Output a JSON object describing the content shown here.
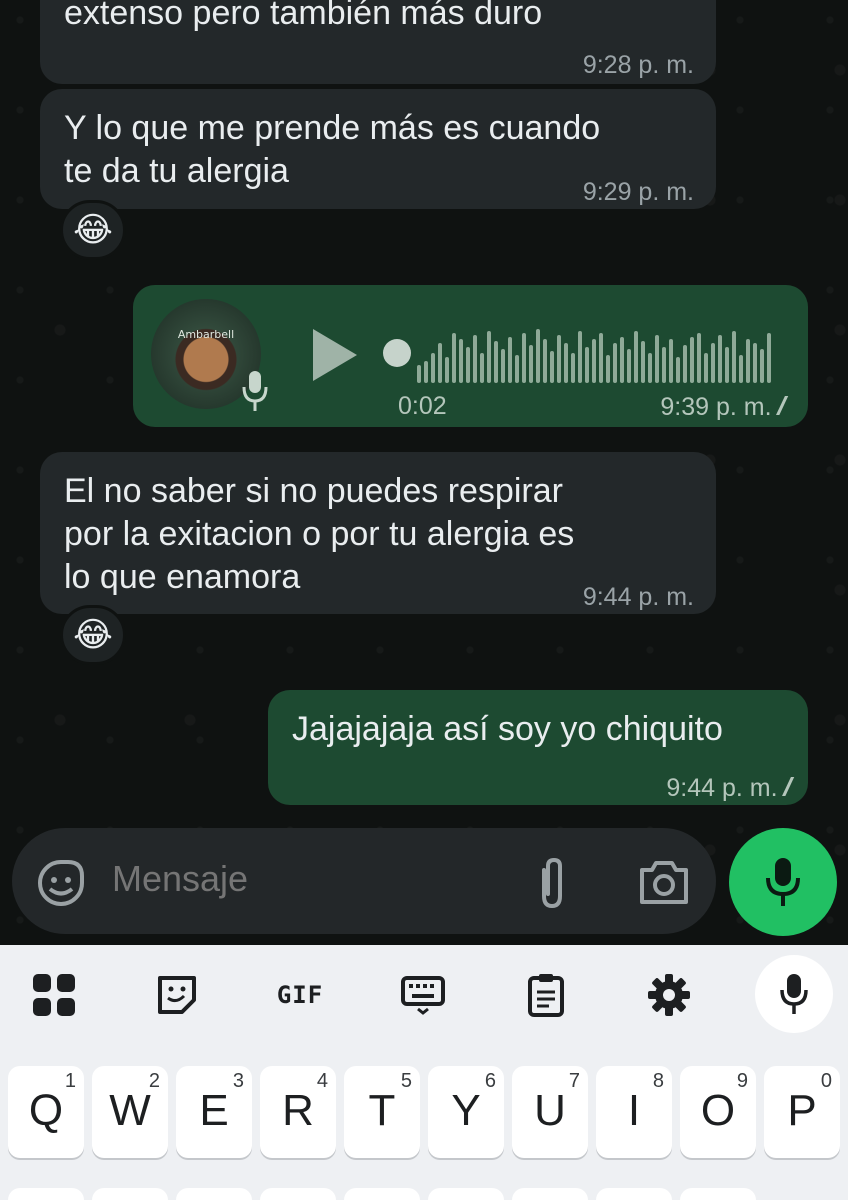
{
  "chat": {
    "messages": [
      {
        "text": "extenso pero también más duro",
        "time": "9:28 p. m."
      },
      {
        "text": "Y lo que me prende más es cuando\nte da tu alergia",
        "time": "9:29 p. m.",
        "reaction": "😂"
      },
      {
        "voice_duration": "0:02",
        "time": "9:39 p. m.",
        "ticks": "//",
        "avatar_label": "Ambarbell"
      },
      {
        "text": "El no saber si no puedes respirar\npor la exitacion o por tu alergia es\nlo que enamora",
        "time": "9:44 p. m.",
        "reaction": "😂"
      },
      {
        "text": "Jajajajaja así soy yo chiquito",
        "time": "9:44 p. m.",
        "ticks": "//"
      }
    ]
  },
  "composer": {
    "placeholder": "Mensaje",
    "icons": [
      "sticker-icon",
      "attach-icon",
      "camera-icon",
      "mic-icon"
    ],
    "accent": "#21c063"
  },
  "keyboard": {
    "toolbar": {
      "gif_label": "GIF"
    },
    "row1": [
      {
        "key": "Q",
        "sup": "1"
      },
      {
        "key": "W",
        "sup": "2"
      },
      {
        "key": "E",
        "sup": "3"
      },
      {
        "key": "R",
        "sup": "4"
      },
      {
        "key": "T",
        "sup": "5"
      },
      {
        "key": "Y",
        "sup": "6"
      },
      {
        "key": "U",
        "sup": "7"
      },
      {
        "key": "I",
        "sup": "8"
      },
      {
        "key": "O",
        "sup": "9"
      },
      {
        "key": "P",
        "sup": "0"
      }
    ]
  }
}
